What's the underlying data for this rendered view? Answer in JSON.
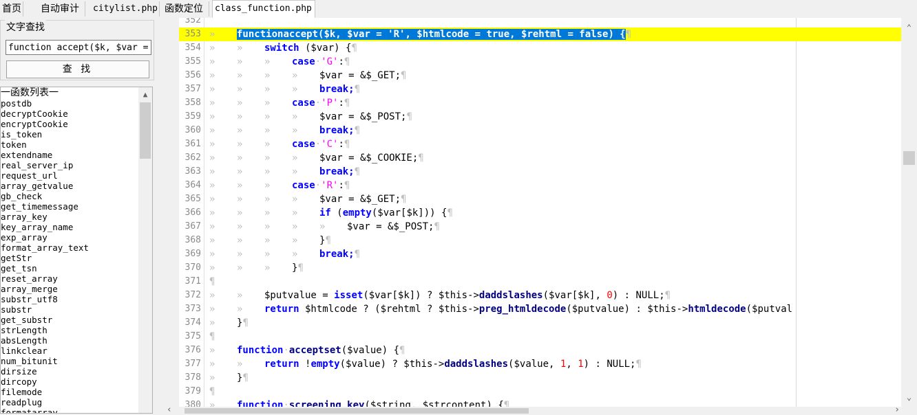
{
  "tabs": [
    {
      "label": "首页"
    },
    {
      "label": "自动审计"
    },
    {
      "label": "citylist.php"
    },
    {
      "label": "函数定位"
    },
    {
      "label": "class_function.php"
    }
  ],
  "search": {
    "title": "文字查找",
    "input_value": "function accept($k, $var = '",
    "button_label": "查 找"
  },
  "func_list": {
    "title": "一函数列表一",
    "items": [
      "postdb",
      "decryptCookie",
      "encryptCookie",
      "is_token",
      "token",
      "extendname",
      "real_server_ip",
      "request_url",
      "array_getvalue",
      "gb_check",
      "get_timemessage",
      "array_key",
      "key_array_name",
      "exp_array",
      "format_array_text",
      "getStr",
      "get_tsn",
      "reset_array",
      "array_merge",
      "substr_utf8",
      "substr",
      "get_substr",
      "strLength",
      "absLength",
      "linkclear",
      "num_bitunit",
      "dirsize",
      "dircopy",
      "filemode",
      "readplug",
      "formatarray"
    ]
  },
  "editor": {
    "line_numbers": [
      "352",
      "353",
      "354",
      "355",
      "356",
      "357",
      "358",
      "359",
      "360",
      "361",
      "362",
      "363",
      "364",
      "365",
      "366",
      "367",
      "368",
      "369",
      "370",
      "371",
      "372",
      "373",
      "374",
      "375",
      "376",
      "377",
      "378",
      "379",
      "380"
    ],
    "tokens": {
      "tab": "»",
      "space_dot": "·",
      "eol": "¶",
      "function": "function",
      "accept_sig": "accept($k, $var = 'R', $htmlcode = true, $rehtml = false) {",
      "switch": "switch",
      "switch_arg": " ($var) {",
      "case": "case",
      "s_G": "'G'",
      "s_P": "'P'",
      "s_C": "'C'",
      "s_R": "'R'",
      "colon": ":",
      "get": "$var = &$_GET;",
      "post": "$var = &$_POST;",
      "cookie": "$var = &$_COOKIE;",
      "break": "break;",
      "if": "if",
      "empty": "empty",
      "if_rest": "($var[$k])) {",
      "if_open": " (",
      "close_brace": "}",
      "putvalue_a": "$putvalue = ",
      "isset": "isset",
      "putvalue_b": "($var[$k]) ? $this->",
      "daddslashes": "daddslashes",
      "putvalue_c": "($var[$k], ",
      "zero": "0",
      "putvalue_d": ") : NULL;",
      "return": "return",
      "ret_a": " $htmlcode ? ($rehtml ? $this->",
      "preg_htmldecode": "preg_htmldecode",
      "ret_b": "($putvalue) : $this->",
      "htmldecode": "htmldecode",
      "ret_c": "($putval",
      "acceptset": "acceptset",
      "acceptset_args": "($value) {",
      "not": " !",
      "ret2_a": "($value) ? $this->",
      "ret2_b": "($value, ",
      "one": "1",
      "comma": ", ",
      "ret2_c": ") : NULL;",
      "screening": "screening_key",
      "screening_args": "($string, $strcontent) {"
    }
  }
}
